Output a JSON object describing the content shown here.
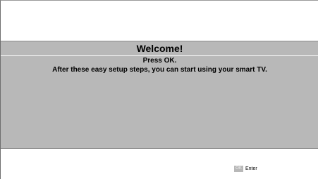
{
  "dialog": {
    "title": "Welcome!",
    "message_line1": "Press OK.",
    "message_line2": "After these easy setup steps, you can start using your smart TV."
  },
  "footer": {
    "key_label": "OK",
    "action_label": "Enter"
  },
  "colors": {
    "panel": "#b8b8b8",
    "background": "#ffffff"
  }
}
